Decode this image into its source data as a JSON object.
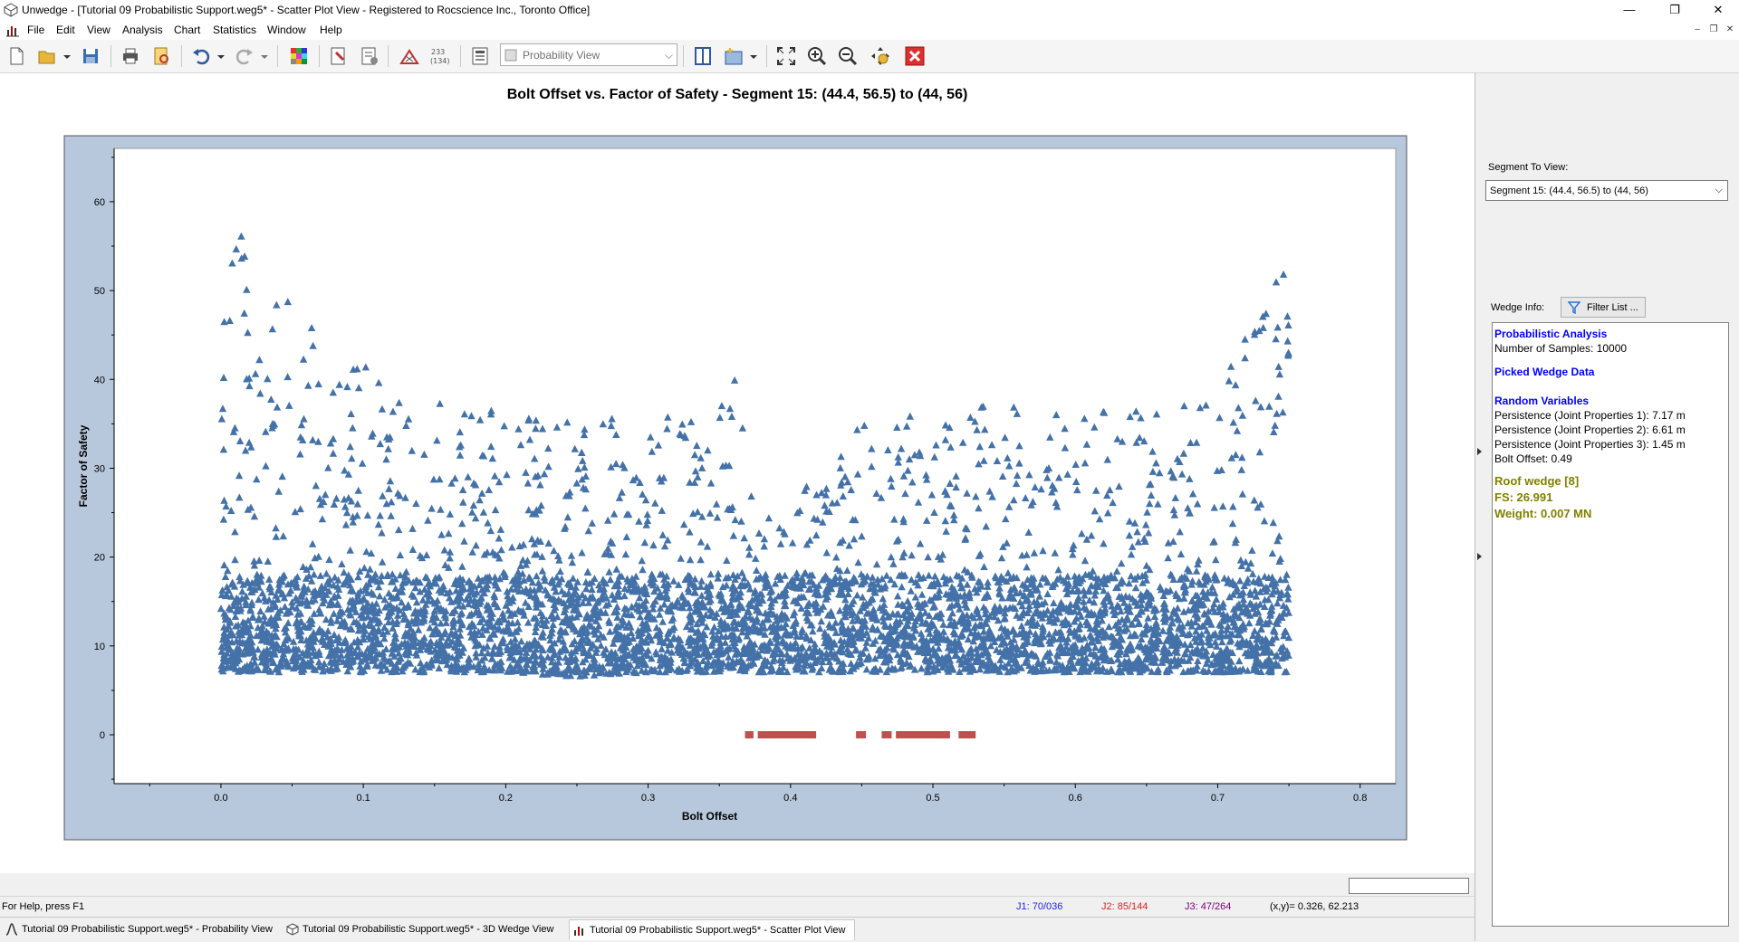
{
  "window": {
    "title": "Unwedge - [Tutorial 09 Probabilistic Support.weg5* - Scatter Plot View - Registered to Rocscience Inc., Toronto Office]",
    "min_label": "—",
    "restore_label": "❐",
    "close_label": "✕"
  },
  "menu": [
    "File",
    "Edit",
    "View",
    "Analysis",
    "Chart",
    "Statistics",
    "Window",
    "Help"
  ],
  "mdi_controls": {
    "min": "–",
    "restore": "❐",
    "close": "✕"
  },
  "toolbar": {
    "view_select": {
      "value": "Probability View"
    }
  },
  "chart_data": {
    "type": "scatter",
    "title": "Bolt Offset  vs. Factor of Safety  - Segment 15: (44.4, 56.5) to (44, 56)",
    "xlabel": "Bolt Offset",
    "ylabel": "Factor of Safety",
    "xlim": [
      -0.075,
      0.825
    ],
    "ylim": [
      -5.5,
      66
    ],
    "xticks": [
      "0.0",
      "0.1",
      "0.2",
      "0.3",
      "0.4",
      "0.5",
      "0.6",
      "0.7",
      "0.8"
    ],
    "xtick_values": [
      0,
      0.1,
      0.2,
      0.3,
      0.4,
      0.5,
      0.6,
      0.7,
      0.8
    ],
    "yticks": [
      "0",
      "10",
      "20",
      "30",
      "40",
      "50",
      "60"
    ],
    "ytick_values": [
      0,
      10,
      20,
      30,
      40,
      50,
      60
    ],
    "marker": "triangle",
    "colors": {
      "safe": "#4472a8",
      "failed": "#c0504d",
      "plot_border": "#b8c8dc"
    },
    "series": [
      {
        "samples": 10000,
        "x_range": [
          0.0,
          0.75
        ],
        "envelope_upper": [
          [
            0.0,
            60
          ],
          [
            0.05,
            48
          ],
          [
            0.1,
            42
          ],
          [
            0.15,
            38
          ],
          [
            0.2,
            36
          ],
          [
            0.25,
            36
          ],
          [
            0.3,
            35
          ],
          [
            0.35,
            38
          ],
          [
            0.365,
            43
          ],
          [
            0.37,
            27
          ],
          [
            0.4,
            26
          ],
          [
            0.45,
            35
          ],
          [
            0.5,
            37
          ],
          [
            0.55,
            37
          ],
          [
            0.6,
            36
          ],
          [
            0.65,
            37
          ],
          [
            0.7,
            39
          ],
          [
            0.73,
            48
          ],
          [
            0.75,
            57
          ]
        ],
        "envelope_lower": [
          [
            0.0,
            5
          ],
          [
            0.2,
            5
          ],
          [
            0.25,
            4.5
          ],
          [
            0.3,
            5
          ],
          [
            0.4,
            5
          ],
          [
            0.5,
            5
          ],
          [
            0.6,
            5
          ],
          [
            0.75,
            5
          ]
        ]
      },
      {
        "y": 0,
        "segments": [
          [
            0.368,
            0.374
          ],
          [
            0.377,
            0.418
          ],
          [
            0.446,
            0.453
          ],
          [
            0.464,
            0.471
          ],
          [
            0.474,
            0.512
          ],
          [
            0.518,
            0.53
          ]
        ]
      }
    ]
  },
  "statusbar": {
    "help": "For Help, press F1",
    "j1": "J1: 70/036",
    "j2": "J2: 85/144",
    "j3": "J3: 47/264",
    "coords": "(x,y)= 0.326, 62.213"
  },
  "tabs": [
    {
      "label": "Tutorial 09 Probabilistic Support.weg5* - Probability View",
      "icon": "probability-icon"
    },
    {
      "label": "Tutorial 09 Probabilistic Support.weg5* - 3D Wedge View",
      "icon": "wedge-3d-icon"
    },
    {
      "label": "Tutorial 09 Probabilistic Support.weg5* - Scatter Plot View",
      "icon": "scatter-chart-icon"
    }
  ],
  "sidepanel": {
    "segment_label": "Segment To View:",
    "segment_value": "Segment 15: (44.4, 56.5) to (44, 56)",
    "wedge_info_label": "Wedge Info:",
    "filter_button": "Filter List ...",
    "info": {
      "prob_heading": "Probabilistic Analysis",
      "samples": "Number of Samples: 10000",
      "picked_heading": "Picked Wedge Data",
      "random_heading": "Random Variables",
      "rv1": "Persistence (Joint Properties 1): 7.17 m",
      "rv2": "Persistence (Joint Properties 2): 6.61 m",
      "rv3": "Persistence (Joint Properties 3): 1.45 m",
      "rv4": "Bolt Offset: 0.49",
      "wedge_name": "Roof wedge [8]",
      "fs": "FS: 26.991",
      "weight": "Weight: 0.007 MN"
    }
  }
}
